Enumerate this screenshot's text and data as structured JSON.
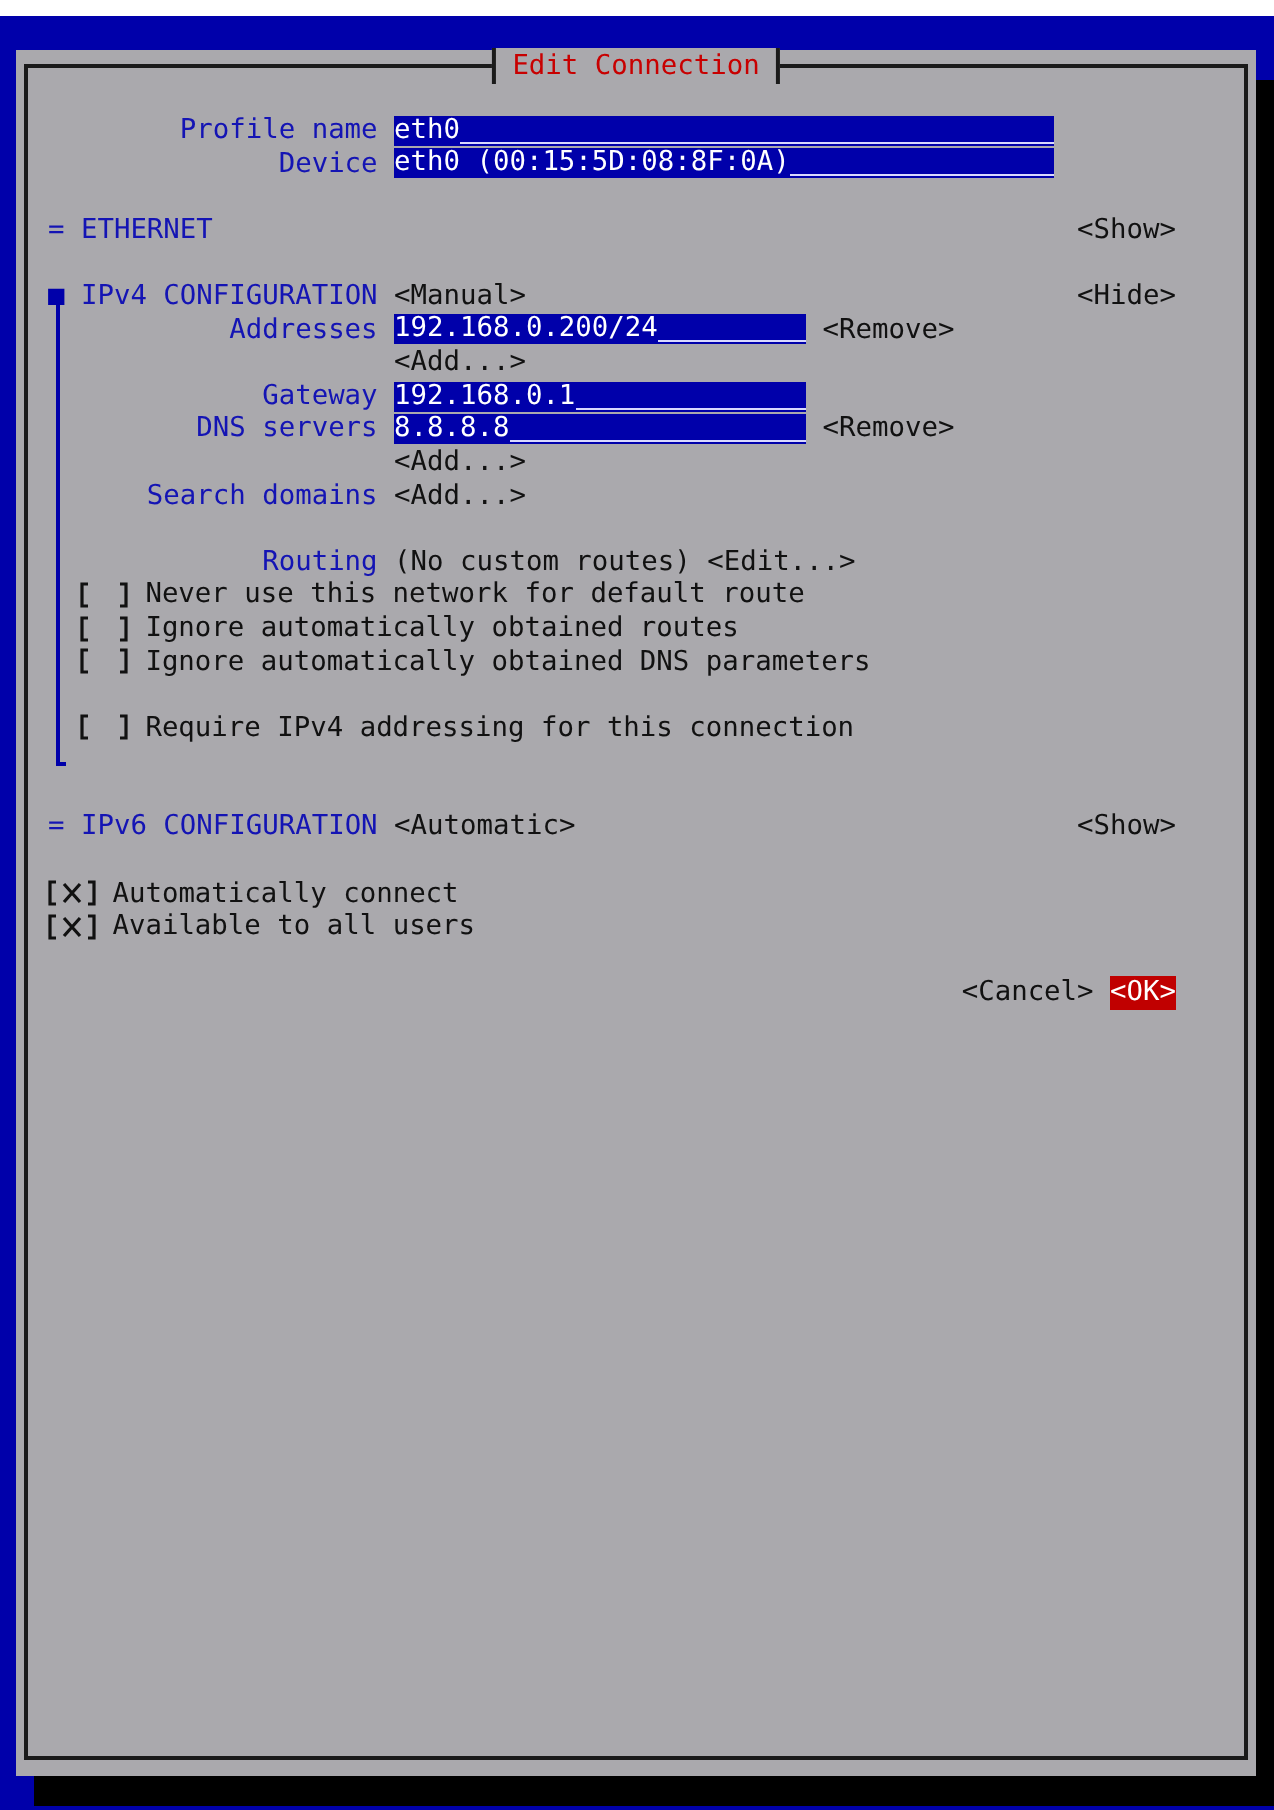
{
  "dialog": {
    "title": "Edit Connection"
  },
  "fields": [
    {
      "label": "Profile name",
      "value": "eth0"
    },
    {
      "label": "Device",
      "value": "eth0 (00:15:5D:08:8F:0A)"
    }
  ],
  "sections": [
    {
      "marker": "=",
      "title": "ETHERNET",
      "toggle": "<Show>",
      "expanded": false
    },
    {
      "marker": "■",
      "title": "IPv4 CONFIGURATION",
      "mode": "<Manual>",
      "toggle": "<Hide>",
      "expanded": true,
      "groups": [
        [
          {
            "kind": "field",
            "label": "Addresses",
            "value": "192.168.0.200/24",
            "action": "<Remove>"
          },
          {
            "kind": "add",
            "button": "<Add...>"
          },
          {
            "kind": "field",
            "label": "Gateway",
            "value": "192.168.0.1"
          },
          {
            "kind": "field",
            "label": "DNS servers",
            "value": "8.8.8.8",
            "action": "<Remove>"
          },
          {
            "kind": "add",
            "button": "<Add...>"
          },
          {
            "kind": "add",
            "label": "Search domains",
            "button": "<Add...>"
          }
        ],
        [
          {
            "kind": "routing",
            "label": "Routing",
            "value": "(No custom routes)",
            "button": "<Edit...>"
          },
          {
            "kind": "checkbox",
            "checked": false,
            "label": "Never use this network for default route"
          },
          {
            "kind": "checkbox",
            "checked": false,
            "label": "Ignore automatically obtained routes"
          },
          {
            "kind": "checkbox",
            "checked": false,
            "label": "Ignore automatically obtained DNS parameters"
          }
        ],
        [
          {
            "kind": "checkbox",
            "checked": false,
            "label": "Require IPv4 addressing for this connection"
          }
        ]
      ]
    },
    {
      "marker": "=",
      "title": "IPv6 CONFIGURATION",
      "mode": "<Automatic>",
      "toggle": "<Show>",
      "expanded": false
    }
  ],
  "options": [
    {
      "checked": true,
      "label": "Automatically connect"
    },
    {
      "checked": true,
      "label": "Available to all users"
    }
  ],
  "buttons": [
    {
      "label": "<Cancel>",
      "selected": false
    },
    {
      "label": "<OK>",
      "selected": true
    }
  ]
}
